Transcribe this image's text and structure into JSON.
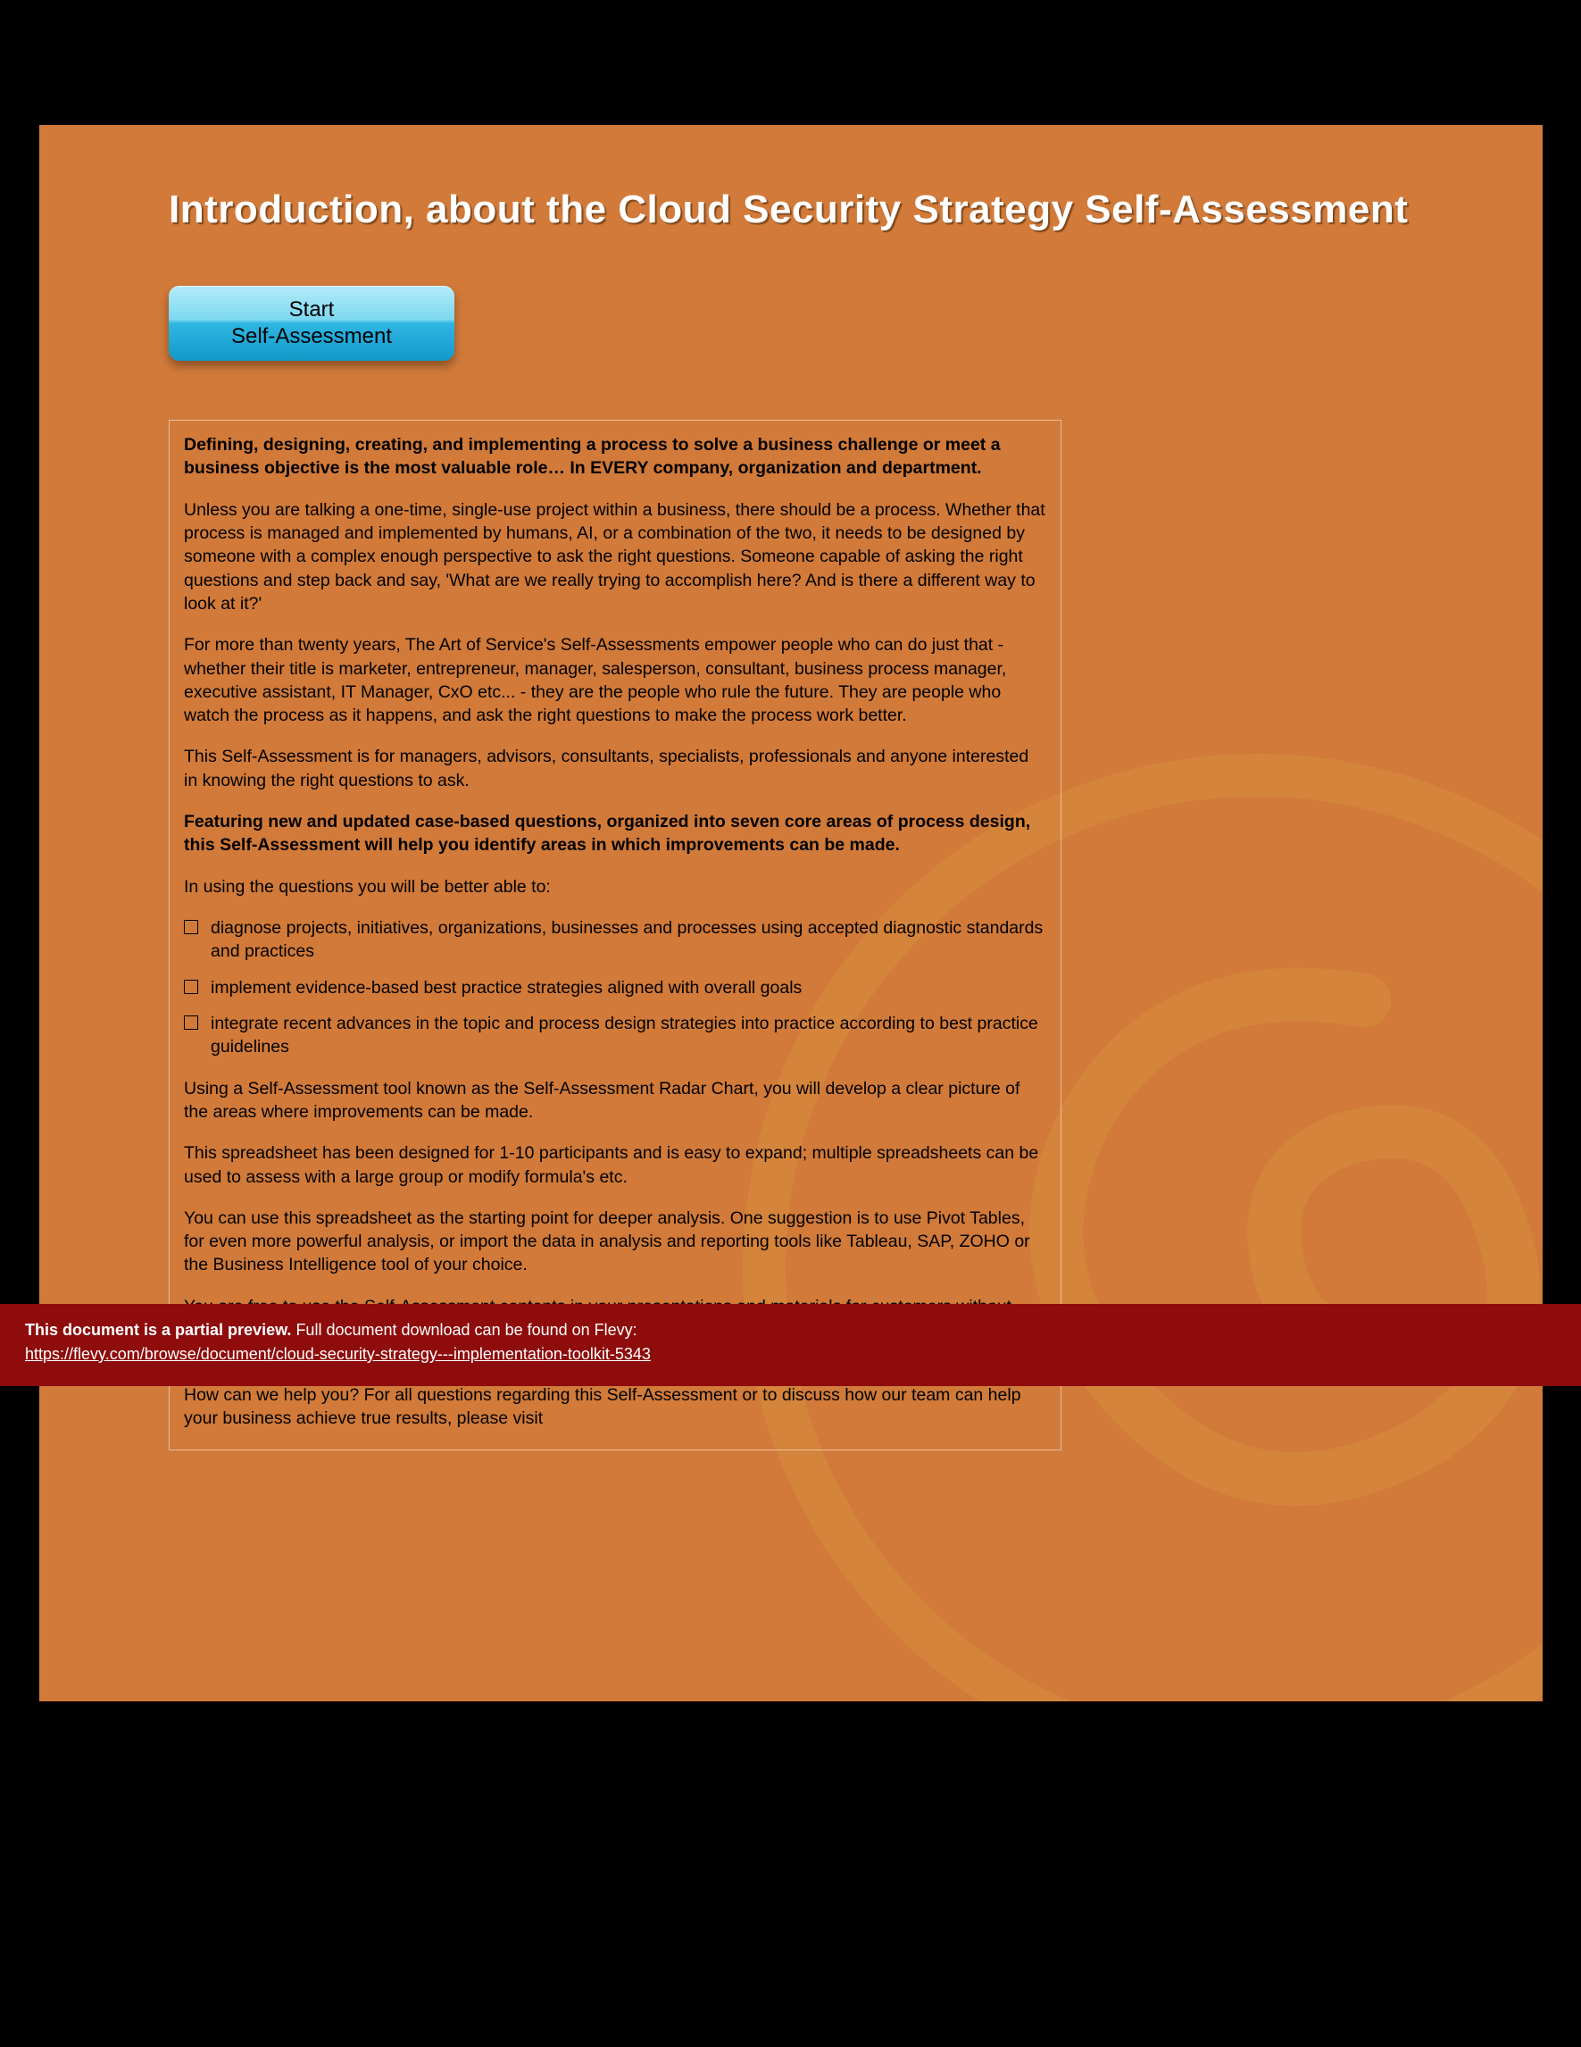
{
  "title": "Introduction, about the Cloud Security Strategy Self-Assessment",
  "button": {
    "line1": "Start",
    "line2": "Self-Assessment"
  },
  "content": {
    "lead_bold": "Defining, designing, creating, and implementing a process to solve a business challenge or meet a business objective is the most valuable role… In EVERY company, organization and department.",
    "para1": "Unless you are talking a one-time, single-use project within a business, there should be a process. Whether that process is managed and implemented by humans, AI, or a combination of the two, it needs to be designed by someone with a complex enough perspective to ask the right questions. Someone capable of asking the right questions and step back and say, 'What are we really trying to accomplish here? And is there a different way to look at it?'",
    "para2": "For more than twenty years, The Art of Service's Self-Assessments empower people who can do just that - whether their title is marketer, entrepreneur, manager, salesperson, consultant, business process manager, executive assistant, IT Manager, CxO etc... - they are the people who rule the future. They are people who watch the process as it happens, and ask the right questions to make the process work better.",
    "para3": "This Self-Assessment is for managers, advisors, consultants, specialists, professionals and anyone interested in knowing the right questions to ask.",
    "feature_bold": "Featuring new and updated case-based questions, organized into seven core areas of process design, this Self-Assessment will help you identify areas in which improvements can be made.",
    "para4": "In using the questions you will be better able to:",
    "bullets": [
      "diagnose projects, initiatives, organizations, businesses and processes using accepted diagnostic standards and practices",
      "implement evidence-based best practice strategies aligned with overall goals",
      "integrate recent advances in the topic and process design strategies into practice according to best practice guidelines"
    ],
    "para5": "Using a Self-Assessment tool known as the Self-Assessment Radar Chart, you will develop a clear picture of the areas where improvements can be made.",
    "para6": "This spreadsheet has been designed for 1-10 participants and is easy to expand; multiple spreadsheets can be used to assess with a large group or modify formula's etc.",
    "para7": "You can use this spreadsheet as the starting point for deeper analysis. One suggestion is to use Pivot Tables, for even more powerful analysis, or import the data in analysis and reporting tools like Tableau, SAP, ZOHO or the Business Intelligence tool of your choice.",
    "para8": "You are free to use the Self-Assessment contents in your presentations and materials for customers without asking us - we are here to help. The Art of Service has helped hundreds of clients to improve execution and meet the needs of customers better by applying process redesign.",
    "para9": "How can we help you? For all questions regarding this Self-Assessment or to discuss how our team can help your business achieve true results, please visit"
  },
  "banner": {
    "bold": "This document is a partial preview.",
    "rest": "Full document download can be found on Flevy:",
    "link": "https://flevy.com/browse/document/cloud-security-strategy---implementation-toolkit-5343"
  }
}
